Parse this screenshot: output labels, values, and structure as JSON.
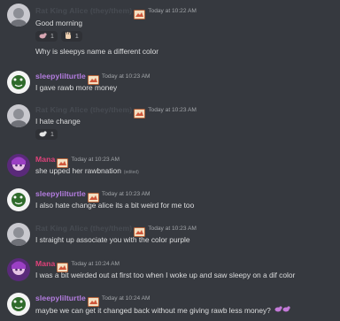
{
  "colors": {
    "alice": "#474b52",
    "turtle": "#b47de0",
    "mana": "#e0427a",
    "text": "#dcddde",
    "time": "#a3a6aa"
  },
  "messages": [
    {
      "author": "Rat King Alice (they/them)",
      "time": "Today at 10:22 AM",
      "lines": [
        "Good morning"
      ],
      "reactions": [
        {
          "emoji": "rat",
          "count": "1"
        },
        {
          "emoji": "hand",
          "count": "1"
        }
      ],
      "lines2": [
        "Why is sleepys name a different color"
      ]
    },
    {
      "author": "sleepylilturtle",
      "time": "Today at 10:23 AM",
      "lines": [
        "I gave rawb more money"
      ]
    },
    {
      "author": "Rat King Alice (they/them)",
      "time": "Today at 10:23 AM",
      "lines": [
        "I hate change"
      ],
      "reactions": [
        {
          "emoji": "rat",
          "count": "1"
        }
      ]
    },
    {
      "author": "Mana",
      "time": "Today at 10:23 AM",
      "lines": [
        "she upped her rawbnation"
      ],
      "edited": "(edited)"
    },
    {
      "author": "sleepylilturtle",
      "time": "Today at 10:23 AM",
      "lines": [
        "I also hate change alice its a bit weird for me too"
      ]
    },
    {
      "author": "Rat King Alice (they/them)",
      "time": "Today at 10:23 AM",
      "lines": [
        "I straight up associate you with the color purple"
      ]
    },
    {
      "author": "Mana",
      "time": "Today at 10:24 AM",
      "lines": [
        "I was a bit weirded out at first too when I woke up and saw sleepy on a dif color"
      ]
    },
    {
      "author": "sleepylilturtle",
      "time": "Today at 10:24 AM",
      "lines": [
        "maybe we can get it changed back without me giving rawb less money?"
      ]
    }
  ]
}
